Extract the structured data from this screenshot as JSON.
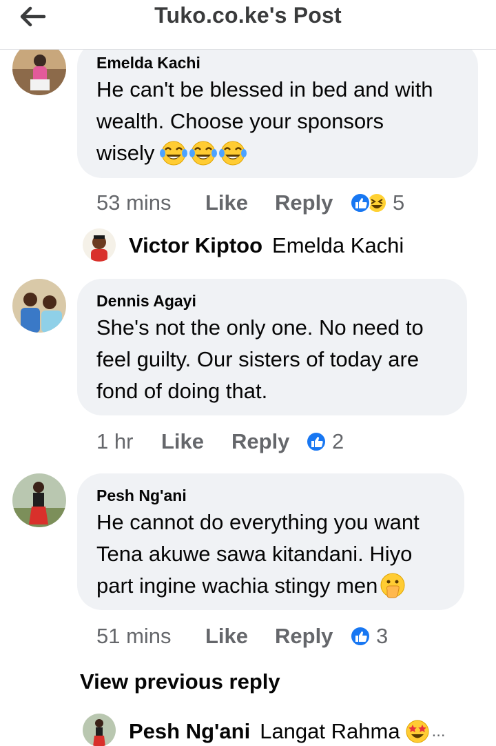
{
  "header": {
    "title": "Tuko.co.ke's Post",
    "back_icon": "arrow-left-icon"
  },
  "comments": [
    {
      "author": "Emelda Kachi",
      "lines": [
        "He can't be blessed in bed and with",
        "wealth. Choose your sponsors",
        "wisely"
      ],
      "emoji": [
        "tears-of-joy",
        "tears-of-joy",
        "tears-of-joy"
      ],
      "time": "53 mins",
      "like": "Like",
      "reply": "Reply",
      "reaction_count": "5",
      "reactions": [
        "like",
        "haha"
      ]
    },
    {
      "author": "Dennis Agayi",
      "lines": [
        "She's not the only one. No need to",
        "feel guilty. Our sisters of today are",
        "fond of doing that."
      ],
      "time": "1 hr",
      "like": "Like",
      "reply": "Reply",
      "reaction_count": "2",
      "reactions": [
        "like"
      ]
    },
    {
      "author": "Pesh Ng'ani",
      "lines": [
        "He cannot do everything you want",
        "Tena akuwe sawa kitandani. Hiyo",
        "part ingine wachia stingy men"
      ],
      "emoji": [
        "hand-over-mouth"
      ],
      "time": "51 mins",
      "like": "Like",
      "reply": "Reply",
      "reaction_count": "3",
      "reactions": [
        "like"
      ]
    }
  ],
  "replies": [
    {
      "name": "Victor Kiptoo",
      "text": "Emelda Kachi"
    },
    {
      "name": "Pesh Ng'ani",
      "text": "Langat Rahma",
      "emoji": "star-struck",
      "more": "..."
    }
  ],
  "view_previous": "View previous reply",
  "colors": {
    "bubble": "#f0f2f5",
    "meta": "#65676b",
    "like_blue": "#1877f2",
    "text": "#050505"
  }
}
